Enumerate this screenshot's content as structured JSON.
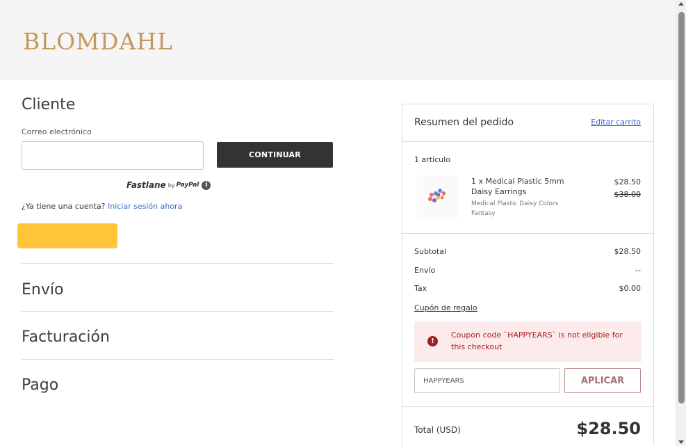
{
  "header": {
    "logo_text": "BLOMDAHL"
  },
  "customer": {
    "title": "Cliente",
    "email_label": "Correo electrónico",
    "email_value": "",
    "continue_label": "CONTINUAR",
    "fastlane_brand": "Fastlane",
    "fastlane_by": "by",
    "fastlane_paypal": "PayPal",
    "info_glyph": "i",
    "account_question": "¿Ya tiene una cuenta?",
    "login_link": "Iniciar sesión ahora"
  },
  "sections": {
    "shipping": "Envío",
    "billing": "Facturación",
    "payment": "Pago"
  },
  "summary": {
    "title": "Resumen del pedido",
    "edit_cart": "Editar carrito",
    "item_count": "1 artículo",
    "item": {
      "name": "1 x Medical Plastic 5mm Daisy Earrings",
      "variant": "Medical Plastic Daisy Colors Fantasy",
      "price": "$28.50",
      "original_price": "$38.00"
    },
    "subtotal_label": "Subtotal",
    "subtotal_value": "$28.50",
    "shipping_label": "Envío",
    "shipping_value": "--",
    "tax_label": "Tax",
    "tax_value": "$0.00",
    "gift_coupon_link": "Cupón de regalo",
    "alert_glyph": "!",
    "alert_text": "Coupon code `HAPPYEARS` is not eligible for this checkout",
    "coupon_value": "HAPPYEARS",
    "apply_label": "APLICAR",
    "total_label": "Total (USD)",
    "total_value": "$28.50"
  },
  "colors": {
    "brand_gold": "#c4975a",
    "paypal_yellow": "#ffc439",
    "link_blue": "#3b6bc8",
    "error_red": "#a31f1f",
    "error_bg": "#fdeaea"
  }
}
